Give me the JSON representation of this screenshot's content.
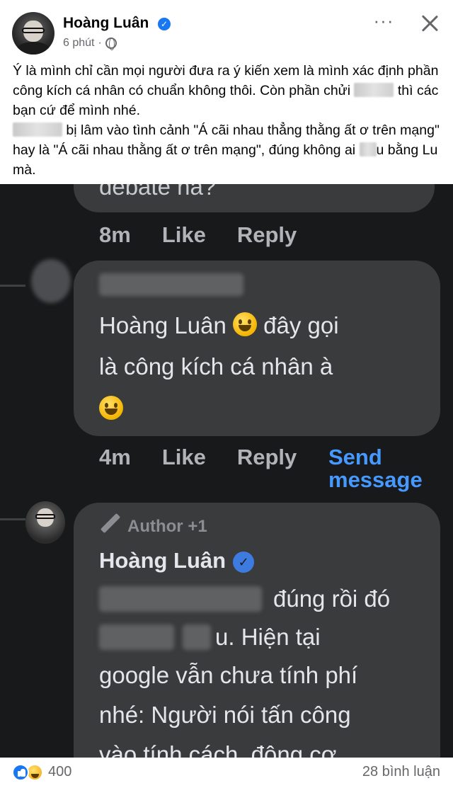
{
  "post": {
    "author_name": "Hoàng Luân",
    "time": "6 phút",
    "dot": "·",
    "text": {
      "line1": "Ý là mình chỉ cần mọi người đưa ra ý kiến xem là mình xác định phần công kích cá nhân có chuẩn không thôi. Còn phần chửi",
      "line1b": "thì các bạn cứ để mình nhé.",
      "line2a": "bị lâm vào tình cảnh \"Á cãi nhau thẳng thằng ất ơ trên mạng\" hay là \"Á cãi nhau thằng ất ơ trên mạng\", đúng không ai",
      "line2b": "u bằng Lu mà."
    }
  },
  "screenshot": {
    "top_comment_fragment": "debate na?",
    "comment1_actions": {
      "time": "8m",
      "like": "Like",
      "reply": "Reply"
    },
    "comment2": {
      "line1": "Hoàng Luân",
      "line1b": "đây gọi",
      "line2": "là công kích cá nhân à"
    },
    "comment2_actions": {
      "time": "4m",
      "like": "Like",
      "reply": "Reply",
      "send_line1": "Send",
      "send_line2": "message"
    },
    "reply": {
      "badge": "Author +1",
      "name": "Hoàng Luân",
      "line1": "đúng rồi đó",
      "line2": "u. Hiện tại",
      "line3": "google vẫn chưa tính phí",
      "line4": "nhé: Người nói tấn công",
      "line5": "vào tính cách, động cơ"
    }
  },
  "footer": {
    "reactions_count": "400",
    "comments": "28 bình luận"
  },
  "colors": {
    "brand": "#1877f2",
    "dark_bg": "#18191a",
    "bubble": "#3a3b3c",
    "link_blue": "#4599ff"
  }
}
